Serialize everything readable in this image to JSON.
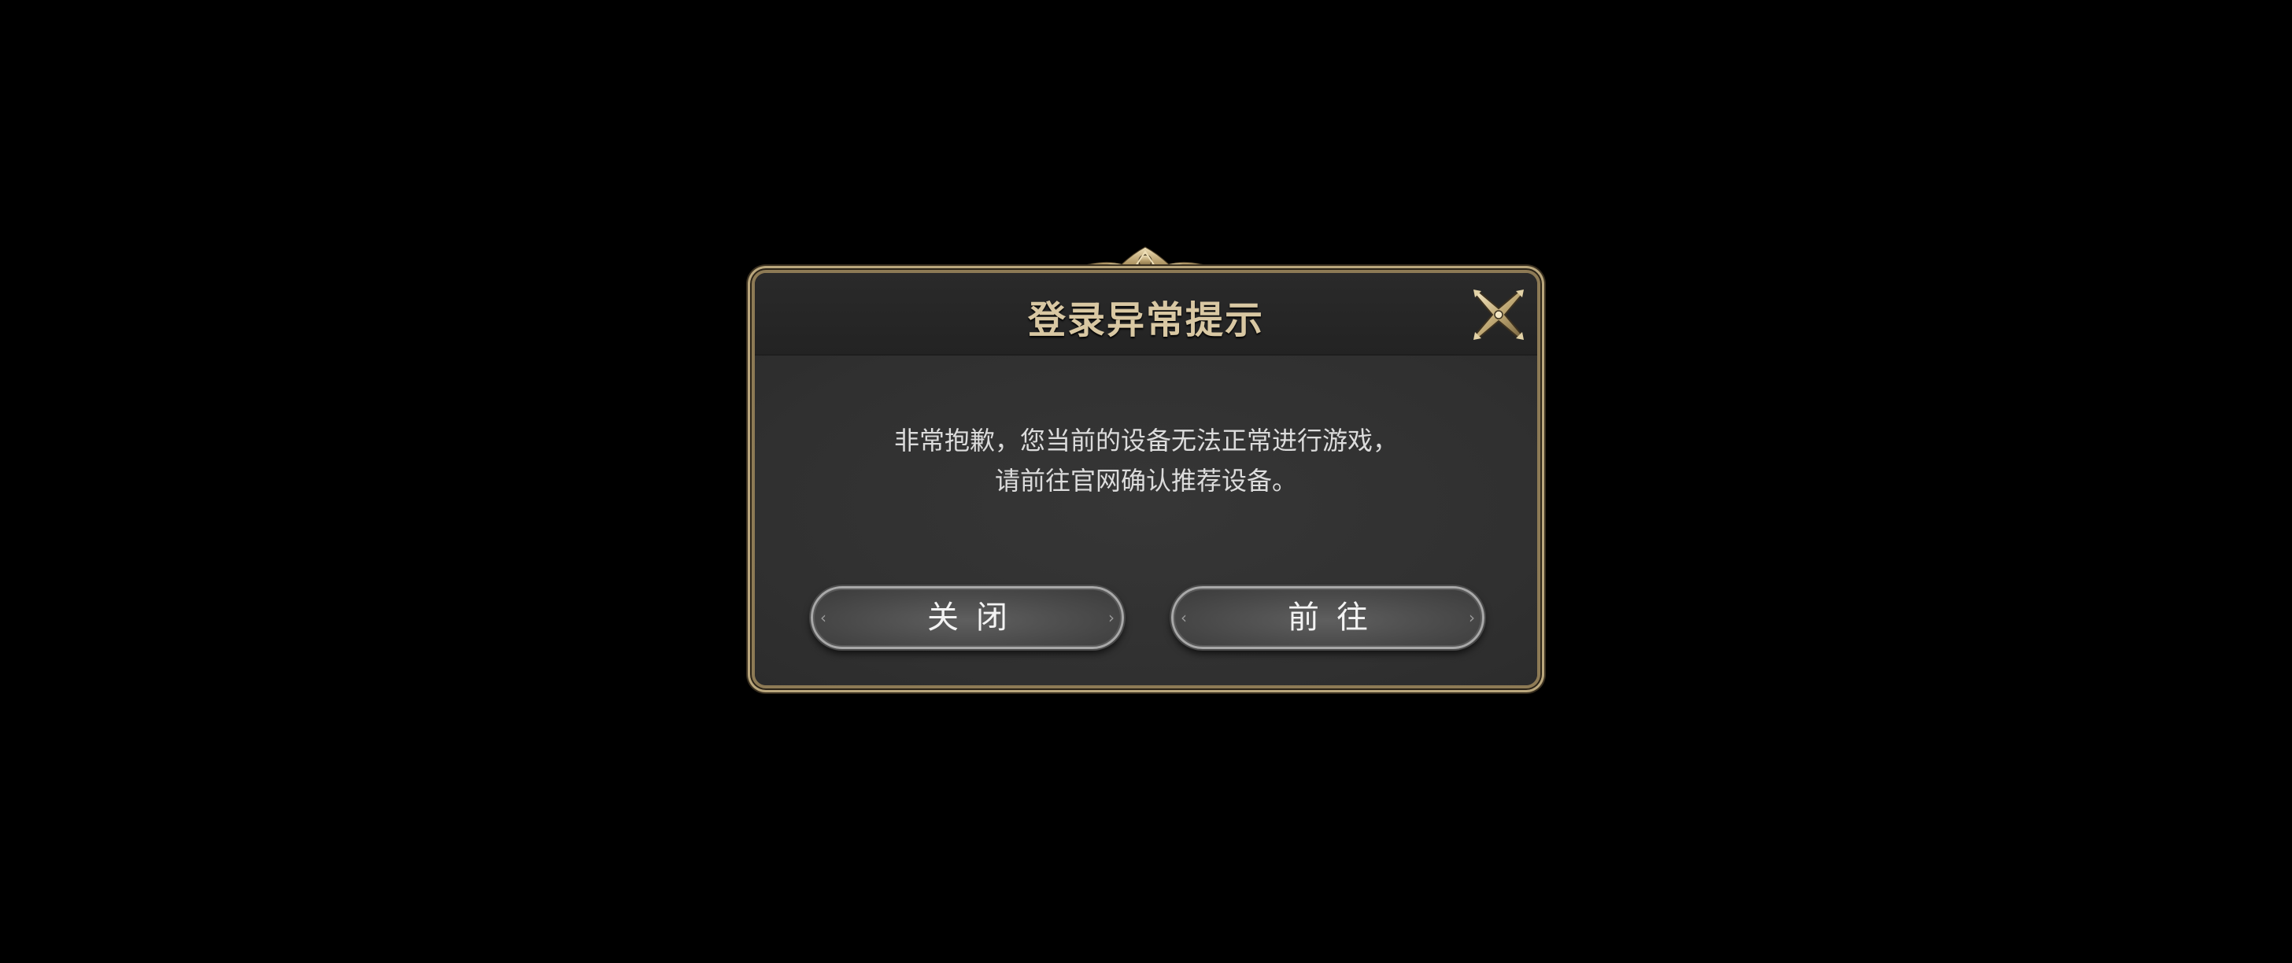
{
  "dialog": {
    "title": "登录异常提示",
    "message_line1": "非常抱歉，您当前的设备无法正常进行游戏，",
    "message_line2": "请前往官网确认推荐设备。",
    "close_button_label": "关闭",
    "go_button_label": "前往",
    "close_icon": "close-x-icon"
  },
  "colors": {
    "background": "#000000",
    "panel": "#323232",
    "title_gold": "#d9c8a3",
    "frame_gold": "#b9a67c",
    "message_text": "#dcdcdc",
    "button_text": "#f3f3f3"
  }
}
